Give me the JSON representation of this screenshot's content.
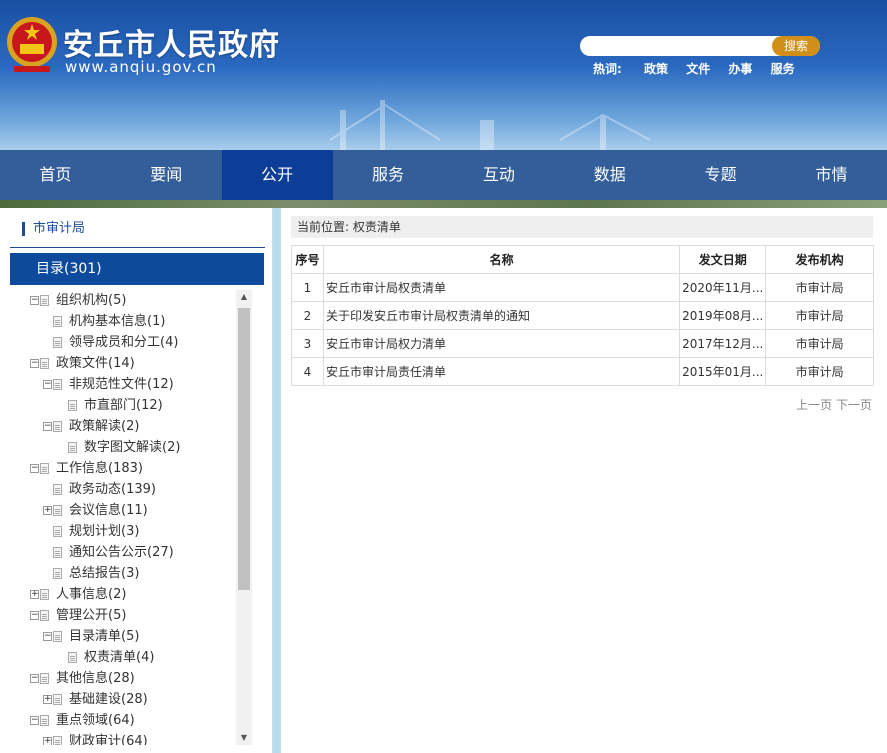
{
  "header": {
    "title": "安丘市人民政府",
    "url": "www.anqiu.gov.cn",
    "search_placeholder": "",
    "search_button": "搜索",
    "hotwords_label": "热词:",
    "hotwords": [
      "政策",
      "文件",
      "办事",
      "服务"
    ]
  },
  "nav": {
    "items": [
      "首页",
      "要闻",
      "公开",
      "服务",
      "互动",
      "数据",
      "专题",
      "市情"
    ],
    "active_index": 2
  },
  "sidebar": {
    "title": "市审计局",
    "catalog": "目录(301)",
    "tree": [
      {
        "label": "组织机构(5)",
        "level": 0,
        "toggle": "−"
      },
      {
        "label": "机构基本信息(1)",
        "level": 1,
        "toggle": ""
      },
      {
        "label": "领导成员和分工(4)",
        "level": 1,
        "toggle": ""
      },
      {
        "label": "政策文件(14)",
        "level": 0,
        "toggle": "−"
      },
      {
        "label": "非规范性文件(12)",
        "level": 1,
        "toggle": "−"
      },
      {
        "label": "市直部门(12)",
        "level": 2,
        "toggle": ""
      },
      {
        "label": "政策解读(2)",
        "level": 1,
        "toggle": "−"
      },
      {
        "label": "数字图文解读(2)",
        "level": 2,
        "toggle": ""
      },
      {
        "label": "工作信息(183)",
        "level": 0,
        "toggle": "−"
      },
      {
        "label": "政务动态(139)",
        "level": 1,
        "toggle": ""
      },
      {
        "label": "会议信息(11)",
        "level": 1,
        "toggle": "+"
      },
      {
        "label": "规划计划(3)",
        "level": 1,
        "toggle": ""
      },
      {
        "label": "通知公告公示(27)",
        "level": 1,
        "toggle": ""
      },
      {
        "label": "总结报告(3)",
        "level": 1,
        "toggle": ""
      },
      {
        "label": "人事信息(2)",
        "level": 0,
        "toggle": "+"
      },
      {
        "label": "管理公开(5)",
        "level": 0,
        "toggle": "−"
      },
      {
        "label": "目录清单(5)",
        "level": 1,
        "toggle": "−"
      },
      {
        "label": "权责清单(4)",
        "level": 2,
        "toggle": ""
      },
      {
        "label": "其他信息(28)",
        "level": 0,
        "toggle": "−"
      },
      {
        "label": "基础建设(28)",
        "level": 1,
        "toggle": "+"
      },
      {
        "label": "重点领域(64)",
        "level": 0,
        "toggle": "−"
      },
      {
        "label": "财政审计(64)",
        "level": 1,
        "toggle": "+"
      }
    ]
  },
  "main": {
    "breadcrumb": "当前位置: 权责清单",
    "columns": [
      "序号",
      "名称",
      "发文日期",
      "发布机构"
    ],
    "rows": [
      {
        "no": "1",
        "name": "安丘市审计局权责清单",
        "date": "2020年11月...",
        "org": "市审计局"
      },
      {
        "no": "2",
        "name": "关于印发安丘市审计局权责清单的通知",
        "date": "2019年08月...",
        "org": "市审计局"
      },
      {
        "no": "3",
        "name": "安丘市审计局权力清单",
        "date": "2017年12月...",
        "org": "市审计局"
      },
      {
        "no": "4",
        "name": "安丘市审计局责任清单",
        "date": "2015年01月...",
        "org": "市审计局"
      }
    ],
    "pager": {
      "prev": "上一页",
      "next": "下一页"
    }
  },
  "colors": {
    "nav_bg": "#275391",
    "nav_active": "#0d3e97",
    "catalog_bg": "#0d4a9b",
    "search_button": "#d18f1a"
  }
}
